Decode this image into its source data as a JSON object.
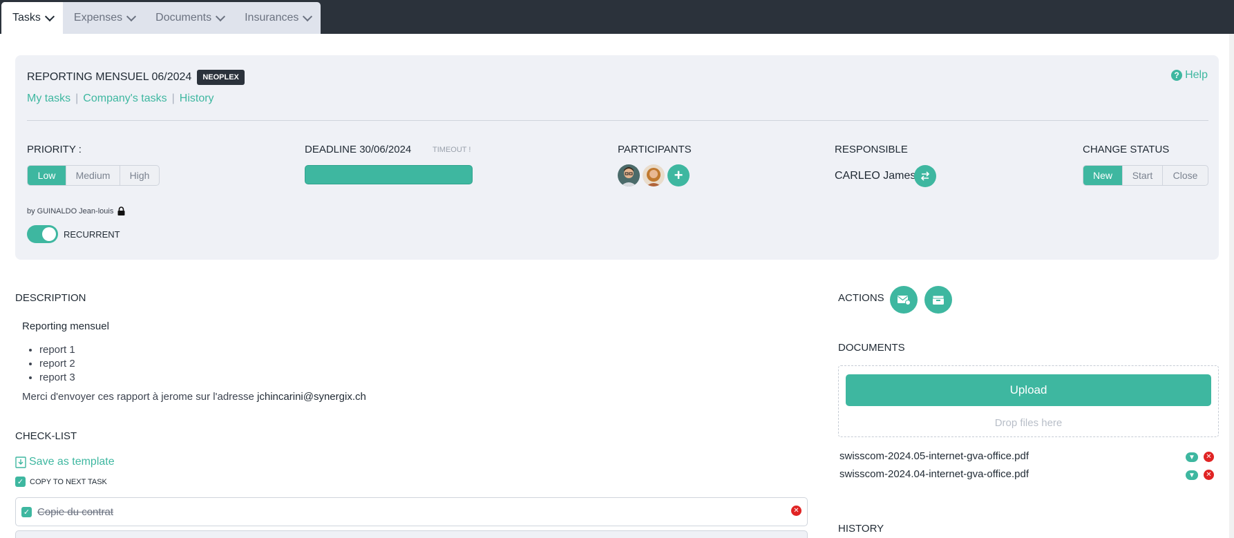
{
  "tabs": [
    {
      "label": "Tasks",
      "active": true
    },
    {
      "label": "Expenses",
      "active": false
    },
    {
      "label": "Documents",
      "active": false
    },
    {
      "label": "Insurances",
      "active": false
    }
  ],
  "task": {
    "title": "REPORTING MENSUEL 06/2024",
    "company_badge": "NEOPLEX",
    "help": "Help",
    "links": [
      "My tasks",
      "Company's tasks",
      "History"
    ]
  },
  "priority": {
    "label": "PRIORITY :",
    "options": [
      "Low",
      "Medium",
      "High"
    ],
    "selected": "Low"
  },
  "deadline": {
    "label": "DEADLINE 30/06/2024",
    "status": "TIMEOUT !",
    "progress_fraction": 1.0
  },
  "participants": {
    "label": "PARTICIPANTS",
    "add_icon": "plus-icon"
  },
  "responsible": {
    "label": "RESPONSIBLE",
    "name": "CARLEO James",
    "swap_icon": "swap-icon"
  },
  "status": {
    "label": "CHANGE STATUS",
    "options": [
      "New",
      "Start",
      "Close"
    ],
    "selected": "New"
  },
  "byline": "by GUINALDO Jean-louis",
  "recurrent": {
    "label": "RECURRENT",
    "on": true
  },
  "description": {
    "heading": "DESCRIPTION",
    "title": "Reporting mensuel",
    "items": [
      "report 1",
      "report 2",
      "report 3"
    ],
    "text": "Merci d'envoyer ces rapport à jerome sur l'adresse",
    "email": "jchincarini@synergix.ch"
  },
  "checklist": {
    "heading": "CHECK-LIST",
    "save_template": "Save as template",
    "copy_next": "COPY TO NEXT TASK",
    "items": [
      {
        "text": "Copie du contrat",
        "done": true
      }
    ]
  },
  "actions": {
    "heading": "ACTIONS",
    "icons": [
      "mail-icon",
      "archive-icon"
    ]
  },
  "documents": {
    "heading": "DOCUMENTS",
    "upload": "Upload",
    "drop": "Drop files here",
    "files": [
      "swisscom-2024.05-internet-gva-office.pdf",
      "swisscom-2024.04-internet-gva-office.pdf"
    ]
  },
  "history": {
    "heading": "HISTORY"
  },
  "colors": {
    "accent": "#3eb7a0",
    "dark": "#2b323b",
    "danger": "#e02424",
    "panel": "#eff1f6"
  }
}
